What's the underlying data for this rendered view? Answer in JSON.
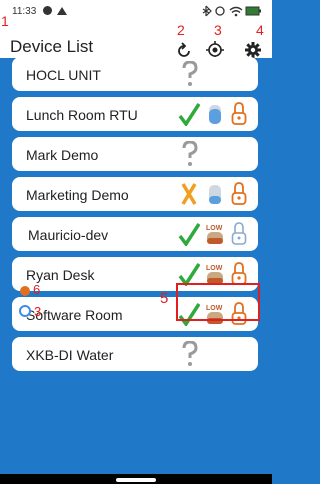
{
  "status": {
    "time": "11:33"
  },
  "header": {
    "title": "Device List"
  },
  "devices": [
    {
      "name": "HOCL UNIT"
    },
    {
      "name": "Lunch Room RTU"
    },
    {
      "name": "Mark Demo"
    },
    {
      "name": "Marketing Demo"
    },
    {
      "name": "Mauricio-dev",
      "low_label": "LOW"
    },
    {
      "name": "Ryan Desk",
      "low_label": "LOW"
    },
    {
      "name": "Software Room",
      "low_label": "LOW"
    },
    {
      "name": "XKB-DI Water"
    }
  ],
  "annotations": {
    "a1": "1",
    "a2": "2",
    "a3": "3",
    "a4": "4",
    "a5": "5",
    "a6": "6",
    "a3b": "3"
  },
  "colors": {
    "background": "#1f78c8",
    "check": "#2eaa3a",
    "warning": "#f0a020",
    "lock": "#e07020",
    "annotation": "#e02020"
  },
  "icons": [
    "refresh-icon",
    "locate-icon",
    "gear-icon",
    "question-icon",
    "check-icon",
    "x-icon",
    "tank-icon",
    "lock-icon"
  ]
}
